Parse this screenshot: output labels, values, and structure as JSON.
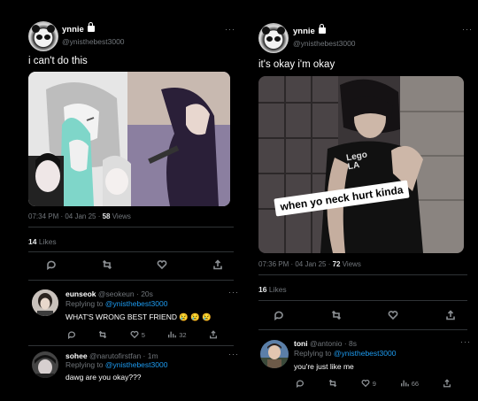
{
  "left": {
    "author": {
      "name": "ynnie",
      "handle": "@ynisthebest3000"
    },
    "more": "···",
    "text": "i can't do this",
    "meta": {
      "time": "07:34 PM · 04 Jan 25 · ",
      "views_count": "58",
      "views_label": " Views"
    },
    "likes": {
      "count": "14",
      "label": " Likes"
    },
    "reply1": {
      "name": "eunseok",
      "handle": "@seokeun · 20s",
      "replying_prefix": "Replying to ",
      "replying_to": "@ynisthebest3000",
      "text": "WHAT'S WRONG BEST FRIEND 😢 😢 😢",
      "likes": "5",
      "views": "32"
    },
    "reply2": {
      "name": "sohee",
      "handle": "@narutofirstfan · 1m",
      "replying_prefix": "Replying to ",
      "replying_to": "@ynisthebest3000",
      "text": "dawg are you okay???"
    }
  },
  "right": {
    "author": {
      "name": "ynnie",
      "handle": "@ynisthebest3000"
    },
    "more": "···",
    "text": "it's okay i'm okay",
    "caption": "when yo neck hurt kinda",
    "shirt_text": "Lego LA",
    "meta": {
      "time": "07:36 PM · 04 Jan 25 · ",
      "views_count": "72",
      "views_label": " Views"
    },
    "likes": {
      "count": "16",
      "label": " Likes"
    },
    "reply1": {
      "name": "toni",
      "handle": "@antonio · 8s",
      "replying_prefix": "Replying to ",
      "replying_to": "@ynisthebest3000",
      "text": "you're just like me",
      "likes": "9",
      "views": "66"
    }
  },
  "colors": {
    "background": "#000000",
    "link": "#1d9bf0",
    "muted": "#71767b",
    "divider": "#2f3336"
  },
  "icons": [
    "reply-icon",
    "retweet-icon",
    "like-icon",
    "share-icon",
    "views-icon",
    "lock-icon",
    "more-icon"
  ]
}
